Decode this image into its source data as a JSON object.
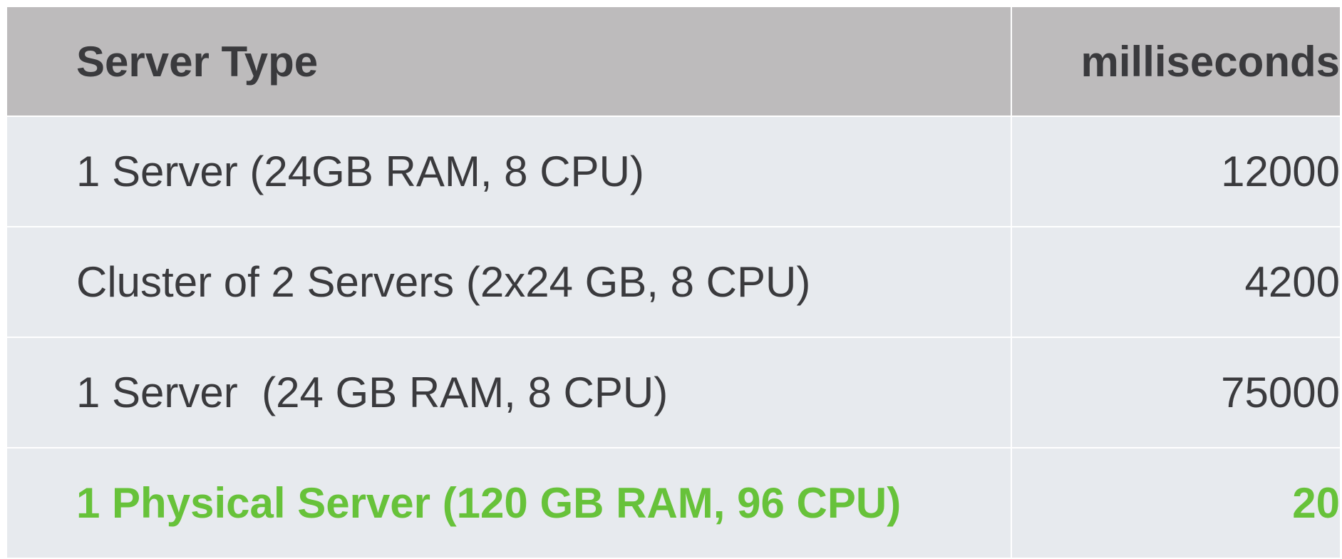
{
  "table": {
    "headers": {
      "server_type": "Server Type",
      "milliseconds": "milliseconds"
    },
    "rows": [
      {
        "server_type": "1 Server (24GB RAM, 8 CPU)",
        "milliseconds": "12000"
      },
      {
        "server_type": "Cluster of 2 Servers (2x24 GB, 8 CPU)",
        "milliseconds": "4200"
      },
      {
        "server_type": "1 Server  (24 GB RAM, 8 CPU)",
        "milliseconds": "75000"
      },
      {
        "server_type": "1 Physical Server (120 GB RAM, 96 CPU)",
        "milliseconds": "20"
      }
    ],
    "highlight_color": "#67c23a",
    "header_bg": "#bdbbbc",
    "row_bg": "#e7eaee"
  }
}
